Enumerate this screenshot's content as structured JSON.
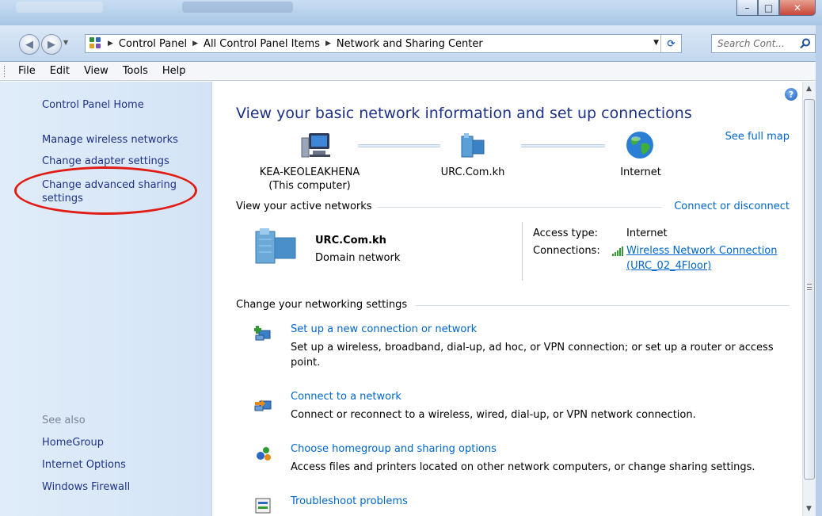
{
  "window": {
    "minimize_glyph": "–",
    "maximize_glyph": "□",
    "close_glyph": "✕"
  },
  "nav": {
    "back_icon": "back-arrow-icon",
    "forward_icon": "forward-arrow-icon",
    "breadcrumbs": [
      "Control Panel",
      "All Control Panel Items",
      "Network and Sharing Center"
    ],
    "search_placeholder": "Search Cont...",
    "refresh_glyph": "⟳"
  },
  "menu": [
    "File",
    "Edit",
    "View",
    "Tools",
    "Help"
  ],
  "sidebar": {
    "home": "Control Panel Home",
    "items": [
      "Manage wireless networks",
      "Change adapter settings",
      "Change advanced sharing",
      "settings"
    ],
    "see_also_label": "See also",
    "see_also": [
      "HomeGroup",
      "Internet Options",
      "Windows Firewall"
    ]
  },
  "main": {
    "title": "View your basic network information and set up connections",
    "see_full_map": "See full map",
    "map": {
      "computer_name": "KEA-KEOLEAKHENA",
      "computer_sub": "(This computer)",
      "domain": "URC.Com.kh",
      "internet": "Internet"
    },
    "active_networks_label": "View your active networks",
    "connect_disconnect": "Connect or disconnect",
    "network": {
      "name": "URC.Com.kh",
      "type": "Domain network",
      "access_type_label": "Access type:",
      "access_type_value": "Internet",
      "connections_label": "Connections:",
      "connection_line1": "Wireless Network Connection",
      "connection_line2": "(URC_02_4Floor)"
    },
    "change_settings_label": "Change your networking settings",
    "tasks": [
      {
        "title": "Set up a new connection or network",
        "desc1": "Set up a wireless, broadband, dial-up, ad hoc, or VPN connection; or set up a router or access",
        "desc2": "point."
      },
      {
        "title": "Connect to a network",
        "desc1": "Connect or reconnect to a wireless, wired, dial-up, or VPN network connection."
      },
      {
        "title": "Choose homegroup and sharing options",
        "desc1": "Access files and printers located on other network computers, or change sharing settings."
      },
      {
        "title": "Troubleshoot problems"
      }
    ]
  },
  "colors": {
    "link": "#0066cc",
    "nav_link": "#1e3287",
    "highlight_circle": "#e11c14"
  }
}
